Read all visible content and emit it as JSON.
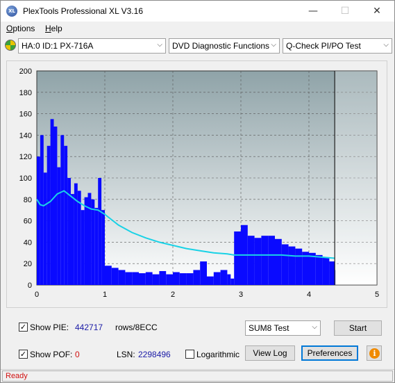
{
  "window": {
    "title": "PlexTools Professional XL V3.16",
    "icon_text": "XL"
  },
  "menu": {
    "items": [
      {
        "label_u": "O",
        "label_rest": "ptions"
      },
      {
        "label_u": "H",
        "label_rest": "elp"
      }
    ]
  },
  "toolbar": {
    "drive": "HA:0 ID:1  PX-716A",
    "function": "DVD Diagnostic Functions",
    "test": "Q-Check PI/PO Test"
  },
  "chart_data": {
    "type": "bar",
    "title": "",
    "xlabel": "",
    "ylabel": "",
    "xlim": [
      0,
      5
    ],
    "ylim": [
      0,
      200
    ],
    "x_ticks": [
      "0",
      "1",
      "2",
      "3",
      "4",
      "5"
    ],
    "y_ticks": [
      "0",
      "20",
      "40",
      "60",
      "80",
      "100",
      "120",
      "140",
      "160",
      "180",
      "200"
    ],
    "grid": true,
    "end_marker_x": 4.38,
    "colors": {
      "pie": "#0a0aff",
      "avg": "#19d2e6",
      "plot_top": "#8fa3a8",
      "plot_bottom": "#ffffff"
    },
    "series": [
      {
        "type": "bar",
        "x": [
          0.0,
          0.05,
          0.1,
          0.15,
          0.2,
          0.25,
          0.3,
          0.35,
          0.4,
          0.45,
          0.5,
          0.55,
          0.6,
          0.65,
          0.7,
          0.75,
          0.8,
          0.85,
          0.9,
          0.95,
          1.0,
          1.1,
          1.2,
          1.3,
          1.4,
          1.5,
          1.6,
          1.7,
          1.8,
          1.9,
          2.0,
          2.1,
          2.2,
          2.3,
          2.4,
          2.5,
          2.6,
          2.7,
          2.8,
          2.85,
          2.9,
          3.0,
          3.1,
          3.2,
          3.3,
          3.4,
          3.5,
          3.6,
          3.7,
          3.8,
          3.9,
          4.0,
          4.1,
          4.2,
          4.3,
          4.38
        ],
        "values": [
          120,
          140,
          105,
          130,
          155,
          148,
          110,
          140,
          130,
          100,
          85,
          95,
          88,
          70,
          82,
          86,
          80,
          72,
          100,
          70,
          18,
          16,
          14,
          12,
          12,
          11,
          12,
          10,
          13,
          10,
          12,
          11,
          11,
          14,
          22,
          8,
          12,
          14,
          10,
          6,
          50,
          56,
          46,
          44,
          46,
          46,
          43,
          38,
          36,
          34,
          31,
          30,
          28,
          26,
          22,
          14
        ]
      },
      {
        "type": "line",
        "x": [
          0.0,
          0.05,
          0.1,
          0.2,
          0.3,
          0.4,
          0.5,
          0.6,
          0.7,
          0.8,
          0.9,
          1.0,
          1.2,
          1.4,
          1.6,
          1.8,
          2.0,
          2.2,
          2.4,
          2.6,
          2.8,
          2.9,
          3.0,
          3.2,
          3.4,
          3.6,
          3.8,
          4.0,
          4.2,
          4.38
        ],
        "values": [
          80,
          75,
          74,
          78,
          85,
          88,
          83,
          78,
          74,
          71,
          70,
          66,
          56,
          49,
          44,
          40,
          37,
          34,
          32,
          30,
          29,
          28,
          28,
          28,
          28,
          28,
          27,
          27,
          26,
          25
        ]
      }
    ]
  },
  "bottom": {
    "show_pie_label": "Show PIE:",
    "pie_value": "442717",
    "rows_label": "rows/8ECC",
    "show_pof_label": "Show POF:",
    "pof_value": "0",
    "lsn_label": "LSN:",
    "lsn_value": "2298496",
    "log_label": "Logarithmic",
    "sum_test": "SUM8 Test",
    "start_label": "Start",
    "viewlog_label": "View Log",
    "prefs_label": "Preferences",
    "show_pie_checked": "✓",
    "show_pof_checked": "✓"
  },
  "status": {
    "text": "Ready"
  }
}
